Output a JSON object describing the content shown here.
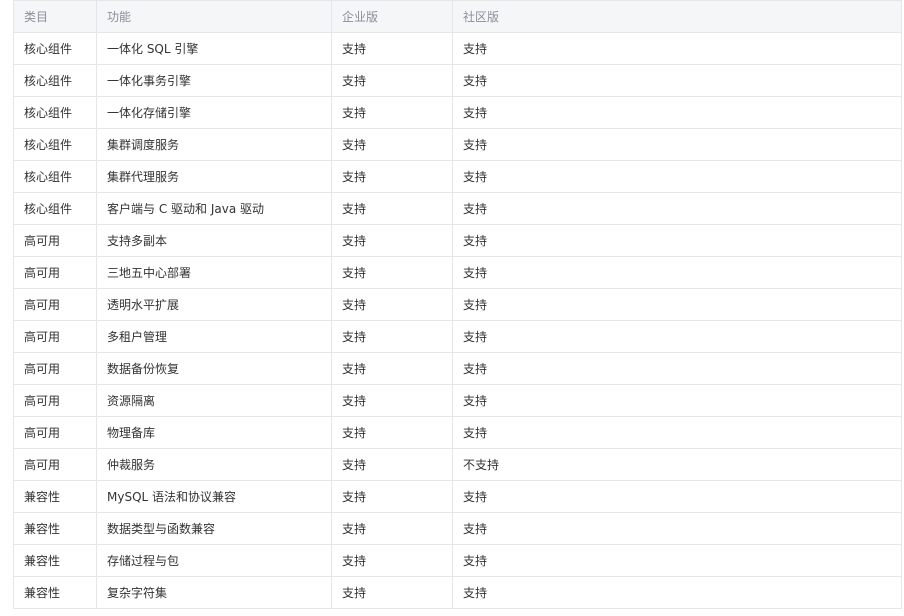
{
  "table": {
    "headers": [
      "类目",
      "功能",
      "企业版",
      "社区版"
    ],
    "rows": [
      [
        "核心组件",
        "一体化 SQL 引擎",
        "支持",
        "支持"
      ],
      [
        "核心组件",
        "一体化事务引擎",
        "支持",
        "支持"
      ],
      [
        "核心组件",
        "一体化存储引擎",
        "支持",
        "支持"
      ],
      [
        "核心组件",
        "集群调度服务",
        "支持",
        "支持"
      ],
      [
        "核心组件",
        "集群代理服务",
        "支持",
        "支持"
      ],
      [
        "核心组件",
        "客户端与 C 驱动和 Java 驱动",
        "支持",
        "支持"
      ],
      [
        "高可用",
        "支持多副本",
        "支持",
        "支持"
      ],
      [
        "高可用",
        "三地五中心部署",
        "支持",
        "支持"
      ],
      [
        "高可用",
        "透明水平扩展",
        "支持",
        "支持"
      ],
      [
        "高可用",
        "多租户管理",
        "支持",
        "支持"
      ],
      [
        "高可用",
        "数据备份恢复",
        "支持",
        "支持"
      ],
      [
        "高可用",
        "资源隔离",
        "支持",
        "支持"
      ],
      [
        "高可用",
        "物理备库",
        "支持",
        "支持"
      ],
      [
        "高可用",
        "仲裁服务",
        "支持",
        "不支持"
      ],
      [
        "兼容性",
        "MySQL 语法和协议兼容",
        "支持",
        "支持"
      ],
      [
        "兼容性",
        "数据类型与函数兼容",
        "支持",
        "支持"
      ],
      [
        "兼容性",
        "存储过程与包",
        "支持",
        "支持"
      ],
      [
        "兼容性",
        "复杂字符集",
        "支持",
        "支持"
      ]
    ]
  }
}
